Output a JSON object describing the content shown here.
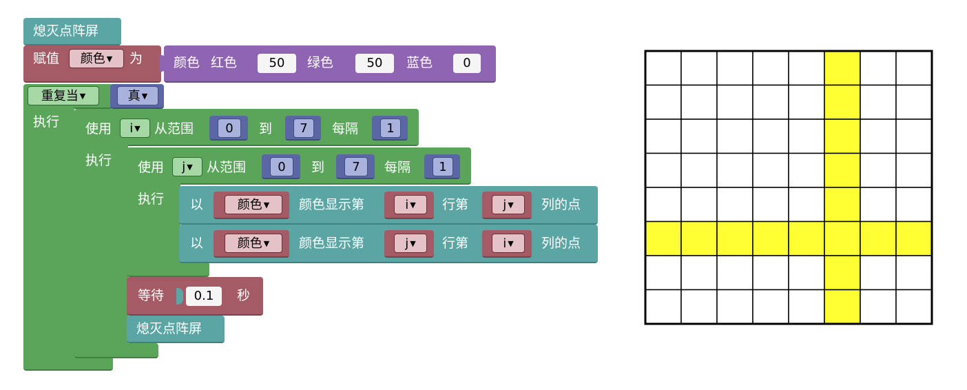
{
  "top_block": {
    "label": "熄灭点阵屏"
  },
  "assign": {
    "prefix": "赋值",
    "variable": "颜色",
    "suffix": "为",
    "color_block": {
      "label": "颜色",
      "red_label": "红色",
      "red_value": "50",
      "green_label": "绿色",
      "green_value": "50",
      "blue_label": "蓝色",
      "blue_value": "0"
    }
  },
  "repeat": {
    "label": "重复当",
    "mode": "真",
    "do_label": "执行"
  },
  "loop_i": {
    "use": "使用",
    "var": "i",
    "from": "从范围",
    "start": "0",
    "to": "到",
    "end": "7",
    "step_label": "每隔",
    "step": "1",
    "do_label": "执行"
  },
  "loop_j": {
    "use": "使用",
    "var": "j",
    "from": "从范围",
    "start": "0",
    "to": "到",
    "end": "7",
    "step_label": "每隔",
    "step": "1",
    "do_label": "执行"
  },
  "show_rows": [
    {
      "prefix": "以",
      "color_var": "颜色",
      "middle": "颜色显示第",
      "row_var": "i",
      "row_label": "行第",
      "col_var": "j",
      "suffix": "列的点"
    },
    {
      "prefix": "以",
      "color_var": "颜色",
      "middle": "颜色显示第",
      "row_var": "j",
      "row_label": "行第",
      "col_var": "i",
      "suffix": "列的点"
    }
  ],
  "wait": {
    "label": "等待",
    "value": "0.1",
    "unit": "秒"
  },
  "clear_block": {
    "label": "熄灭点阵屏"
  },
  "matrix": {
    "rows": 8,
    "cols": 8,
    "on_color": "#ffff33",
    "off_color": "#ffffff",
    "line_color": "#000000",
    "cells": [
      [
        0,
        0,
        0,
        0,
        0,
        1,
        0,
        0
      ],
      [
        0,
        0,
        0,
        0,
        0,
        1,
        0,
        0
      ],
      [
        0,
        0,
        0,
        0,
        0,
        1,
        0,
        0
      ],
      [
        0,
        0,
        0,
        0,
        0,
        1,
        0,
        0
      ],
      [
        0,
        0,
        0,
        0,
        0,
        1,
        0,
        0
      ],
      [
        1,
        1,
        1,
        1,
        1,
        1,
        1,
        1
      ],
      [
        0,
        0,
        0,
        0,
        0,
        1,
        0,
        0
      ],
      [
        0,
        0,
        0,
        0,
        0,
        1,
        0,
        0
      ]
    ]
  },
  "colors": {
    "teal": "#5ba5a5",
    "red": "#a55b65",
    "purple": "#8e64b3",
    "green": "#5ba55b",
    "blue": "#5b67a5"
  }
}
